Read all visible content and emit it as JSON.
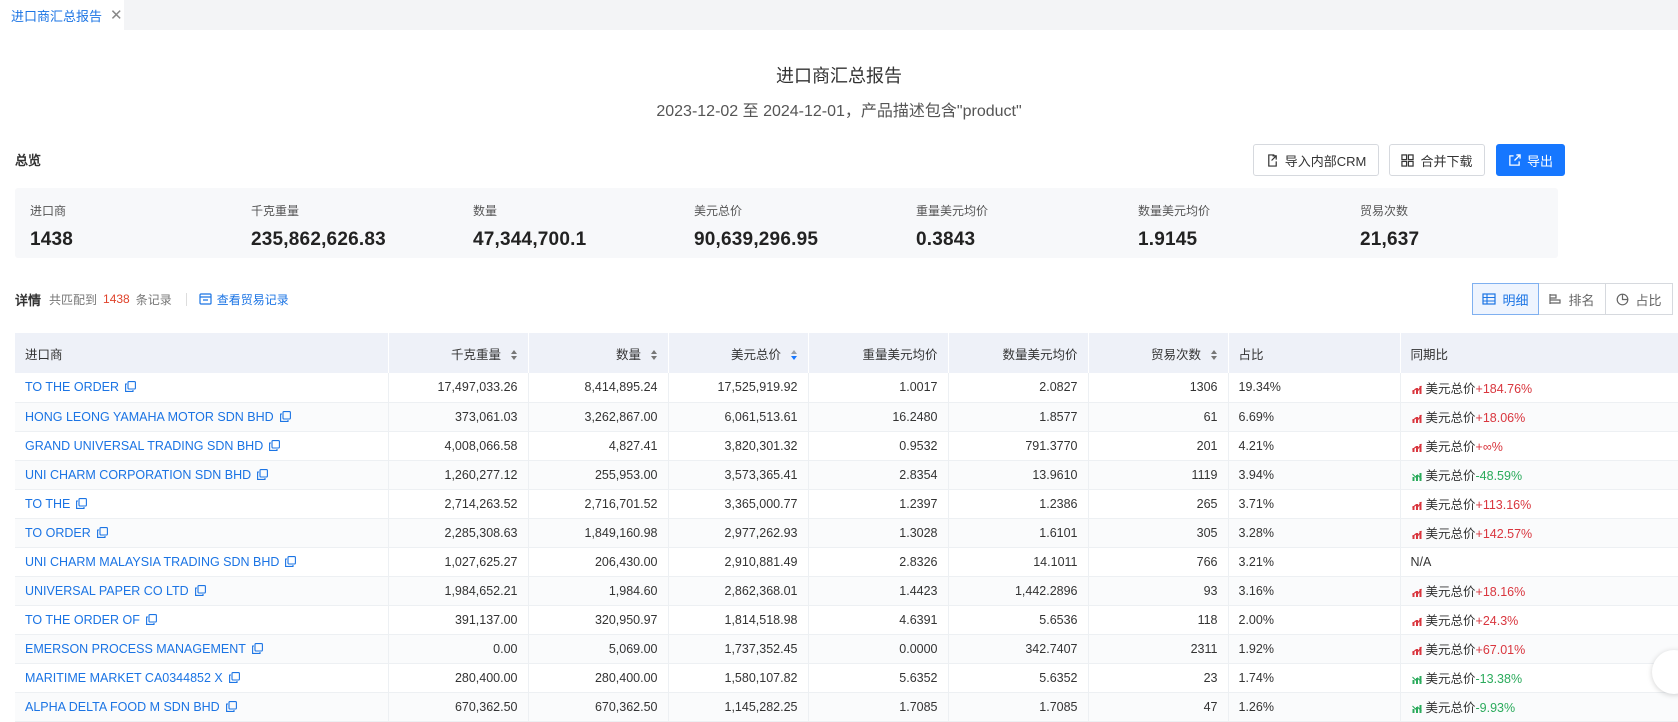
{
  "tab": {
    "label": "进口商汇总报告",
    "close": "✕"
  },
  "report": {
    "title": "进口商汇总报告",
    "subtitle": "2023-12-02 至 2024-12-01，产品描述包含\"product\""
  },
  "overview": {
    "label": "总览",
    "buttons": {
      "crm": "导入内部CRM",
      "merge_download": "合并下载",
      "export": "导出"
    },
    "cards": [
      {
        "label": "进口商",
        "value": "1438"
      },
      {
        "label": "千克重量",
        "value": "235,862,626.83"
      },
      {
        "label": "数量",
        "value": "47,344,700.1"
      },
      {
        "label": "美元总价",
        "value": "90,639,296.95"
      },
      {
        "label": "重量美元均价",
        "value": "0.3843"
      },
      {
        "label": "数量美元均价",
        "value": "1.9145"
      },
      {
        "label": "贸易次数",
        "value": "21,637"
      }
    ]
  },
  "details": {
    "title": "详情",
    "matched_prefix": "共匹配到",
    "matched_count": "1438",
    "matched_suffix": "条记录",
    "view_records": "查看贸易记录",
    "views": [
      "明细",
      "排名",
      "占比"
    ]
  },
  "table": {
    "columns": [
      "进口商",
      "千克重量",
      "数量",
      "美元总价",
      "重量美元均价",
      "数量美元均价",
      "贸易次数",
      "占比",
      "同期比"
    ],
    "rows": [
      {
        "importer": "TO THE ORDER",
        "kg": "17,497,033.26",
        "qty": "8,414,895.24",
        "usd": "17,525,919.92",
        "avg_w": "1.0017",
        "avg_q": "2.0827",
        "trades": "1306",
        "share": "19.34%",
        "yoy_label": "美元总价",
        "yoy_value": "+184.76%",
        "yoy_dir": "up"
      },
      {
        "importer": "HONG LEONG YAMAHA MOTOR SDN BHD",
        "kg": "373,061.03",
        "qty": "3,262,867.00",
        "usd": "6,061,513.61",
        "avg_w": "16.2480",
        "avg_q": "1.8577",
        "trades": "61",
        "share": "6.69%",
        "yoy_label": "美元总价",
        "yoy_value": "+18.06%",
        "yoy_dir": "up"
      },
      {
        "importer": "GRAND UNIVERSAL TRADING SDN BHD",
        "kg": "4,008,066.58",
        "qty": "4,827.41",
        "usd": "3,820,301.32",
        "avg_w": "0.9532",
        "avg_q": "791.3770",
        "trades": "201",
        "share": "4.21%",
        "yoy_label": "美元总价",
        "yoy_value": "+∞%",
        "yoy_dir": "up"
      },
      {
        "importer": "UNI CHARM CORPORATION SDN BHD",
        "kg": "1,260,277.12",
        "qty": "255,953.00",
        "usd": "3,573,365.41",
        "avg_w": "2.8354",
        "avg_q": "13.9610",
        "trades": "1119",
        "share": "3.94%",
        "yoy_label": "美元总价",
        "yoy_value": "-48.59%",
        "yoy_dir": "down"
      },
      {
        "importer": "TO THE",
        "kg": "2,714,263.52",
        "qty": "2,716,701.52",
        "usd": "3,365,000.77",
        "avg_w": "1.2397",
        "avg_q": "1.2386",
        "trades": "265",
        "share": "3.71%",
        "yoy_label": "美元总价",
        "yoy_value": "+113.16%",
        "yoy_dir": "up"
      },
      {
        "importer": "TO ORDER",
        "kg": "2,285,308.63",
        "qty": "1,849,160.98",
        "usd": "2,977,262.93",
        "avg_w": "1.3028",
        "avg_q": "1.6101",
        "trades": "305",
        "share": "3.28%",
        "yoy_label": "美元总价",
        "yoy_value": "+142.57%",
        "yoy_dir": "up"
      },
      {
        "importer": "UNI CHARM MALAYSIA TRADING SDN BHD",
        "kg": "1,027,625.27",
        "qty": "206,430.00",
        "usd": "2,910,881.49",
        "avg_w": "2.8326",
        "avg_q": "14.1011",
        "trades": "766",
        "share": "3.21%",
        "yoy_label": "",
        "yoy_value": "N/A",
        "yoy_dir": "none"
      },
      {
        "importer": "UNIVERSAL PAPER CO LTD",
        "kg": "1,984,652.21",
        "qty": "1,984.60",
        "usd": "2,862,368.01",
        "avg_w": "1.4423",
        "avg_q": "1,442.2896",
        "trades": "93",
        "share": "3.16%",
        "yoy_label": "美元总价",
        "yoy_value": "+18.16%",
        "yoy_dir": "up"
      },
      {
        "importer": "TO THE ORDER OF",
        "kg": "391,137.00",
        "qty": "320,950.97",
        "usd": "1,814,518.98",
        "avg_w": "4.6391",
        "avg_q": "5.6536",
        "trades": "118",
        "share": "2.00%",
        "yoy_label": "美元总价",
        "yoy_value": "+24.3%",
        "yoy_dir": "up"
      },
      {
        "importer": "EMERSON PROCESS MANAGEMENT",
        "kg": "0.00",
        "qty": "5,069.00",
        "usd": "1,737,352.45",
        "avg_w": "0.0000",
        "avg_q": "342.7407",
        "trades": "2311",
        "share": "1.92%",
        "yoy_label": "美元总价",
        "yoy_value": "+67.01%",
        "yoy_dir": "up"
      },
      {
        "importer": "MARITIME MARKET CA0344852 X",
        "kg": "280,400.00",
        "qty": "280,400.00",
        "usd": "1,580,107.82",
        "avg_w": "5.6352",
        "avg_q": "5.6352",
        "trades": "23",
        "share": "1.74%",
        "yoy_label": "美元总价",
        "yoy_value": "-13.38%",
        "yoy_dir": "down"
      },
      {
        "importer": "ALPHA DELTA FOOD M SDN BHD",
        "kg": "670,362.50",
        "qty": "670,362.50",
        "usd": "1,145,282.25",
        "avg_w": "1.7085",
        "avg_q": "1.7085",
        "trades": "47",
        "share": "1.26%",
        "yoy_label": "美元总价",
        "yoy_value": "-9.93%",
        "yoy_dir": "down"
      }
    ]
  },
  "colors": {
    "accent": "#1677ff",
    "up": "#d9363e",
    "down": "#2bab5c"
  }
}
